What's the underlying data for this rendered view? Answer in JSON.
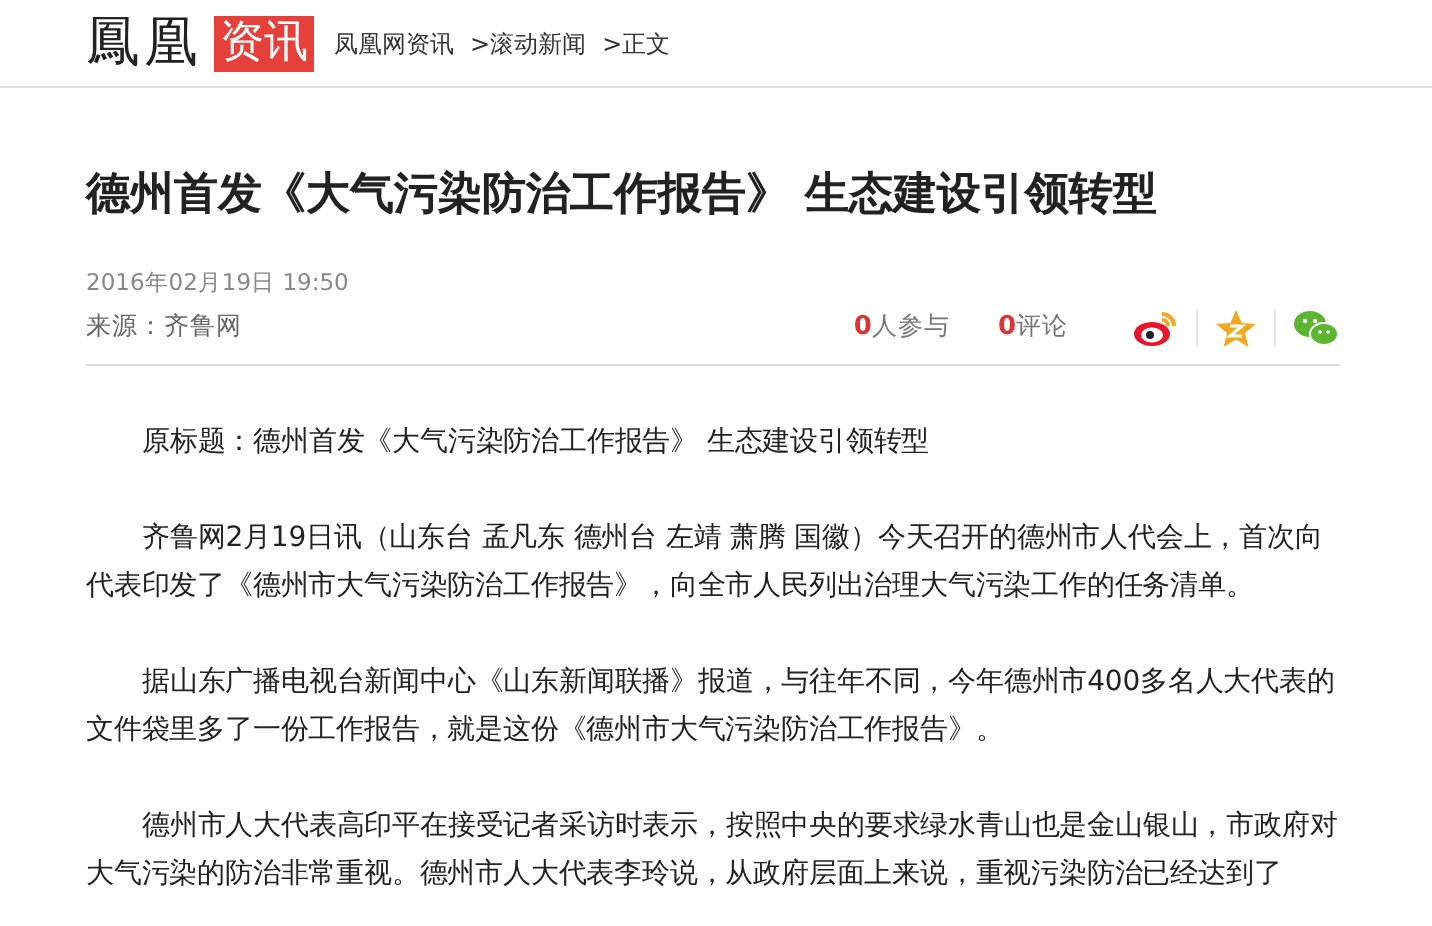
{
  "header": {
    "logo_text": "鳳凰",
    "logo_badge": "资讯",
    "breadcrumb": [
      "凤凰网资讯",
      ">滚动新闻",
      ">正文"
    ]
  },
  "article": {
    "title": "德州首发《大气污染防治工作报告》 生态建设引领转型",
    "date": "2016年02月19日  19:50",
    "source": "来源：齐鲁网",
    "stats": [
      {
        "count": "0",
        "label": "人参与"
      },
      {
        "count": "0",
        "label": "评论"
      }
    ],
    "paragraphs": [
      "原标题：德州首发《大气污染防治工作报告》 生态建设引领转型",
      "齐鲁网2月19日讯（山东台 孟凡东  德州台  左靖  萧腾  国徽）今天召开的德州市人代会上，首次向代表印发了《德州市大气污染防治工作报告》，向全市人民列出治理大气污染工作的任务清单。",
      "据山东广播电视台新闻中心《山东新闻联播》报道，与往年不同，今年德州市400多名人大代表的文件袋里多了一份工作报告，就是这份《德州市大气污染防治工作报告》。",
      "德州市人大代表高印平在接受记者采访时表示，按照中央的要求绿水青山也是金山银山，市政府对大气污染的防治非常重视。德州市人大代表李玲说，从政府层面上来说，重视污染防治已经达到了"
    ]
  }
}
